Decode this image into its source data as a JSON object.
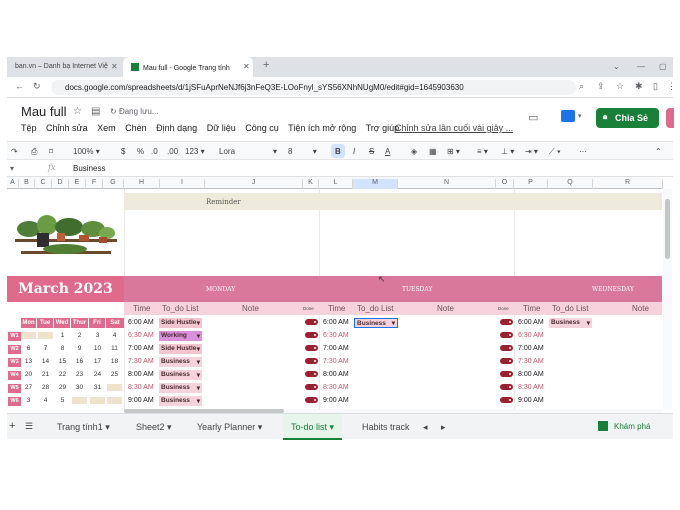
{
  "browser": {
    "tabs": [
      {
        "label": "ban.vn – Danh bạ Internet Việ"
      },
      {
        "label": "Mau full - Google Trang tính"
      }
    ],
    "url": "docs.google.com/spreadsheets/d/1jSFuAprNeNJf6j3nFeQ3E-LOoFnyl_sYS56XNhNUgM0/edit#gid=1645903630"
  },
  "sheets": {
    "doc_title": "Mau full",
    "saving_status": "Đang lưu...",
    "menu": [
      "Tệp",
      "Chỉnh sửa",
      "Xem",
      "Chèn",
      "Định dạng",
      "Dữ liệu",
      "Công cụ",
      "Tiện ích mở rộng",
      "Trợ giúp"
    ],
    "last_edit": "Chỉnh sửa lần cuối vài giây ...",
    "share_label": "Chia Sẻ",
    "toolbar": {
      "zoom": "100%",
      "currency": "$",
      "percent": "%",
      "dec_less": ".0",
      "dec_more": ".00",
      "format": "123",
      "font": "Lora",
      "size": "8",
      "bold": "B",
      "italic": "I",
      "strike": "S",
      "textcolor": "A"
    },
    "formula_value": "Business",
    "columns": [
      "A",
      "B",
      "C",
      "D",
      "E",
      "F",
      "G",
      "H",
      "I",
      "J",
      "K",
      "L",
      "M",
      "N",
      "O",
      "P",
      "Q",
      "R"
    ]
  },
  "planner": {
    "reminder": "Reminder",
    "month": "March 2023",
    "days": [
      "MONDAY",
      "TUESDAY",
      "WEDNESDAY"
    ],
    "subheaders": {
      "time": "Time",
      "todo": "To_do List",
      "note": "Note",
      "done": "Done"
    },
    "cal_days": [
      "Mon",
      "Tue",
      "Wed",
      "Thur",
      "Fri",
      "Sat"
    ],
    "weeks": [
      {
        "label": "W1",
        "days": [
          "27",
          "28",
          "1",
          "2",
          "3",
          "4"
        ],
        "dim": [
          true,
          true,
          false,
          false,
          false,
          false
        ]
      },
      {
        "label": "W2",
        "days": [
          "6",
          "7",
          "8",
          "9",
          "10",
          "11"
        ],
        "dim": [
          false,
          false,
          false,
          false,
          false,
          false
        ]
      },
      {
        "label": "W3",
        "days": [
          "13",
          "14",
          "15",
          "16",
          "17",
          "18"
        ],
        "dim": [
          false,
          false,
          false,
          false,
          false,
          false
        ]
      },
      {
        "label": "W4",
        "days": [
          "20",
          "21",
          "22",
          "23",
          "24",
          "25"
        ],
        "dim": [
          false,
          false,
          false,
          false,
          false,
          false
        ]
      },
      {
        "label": "W5",
        "days": [
          "27",
          "28",
          "29",
          "30",
          "31",
          "1"
        ],
        "dim": [
          false,
          false,
          false,
          false,
          false,
          true
        ]
      },
      {
        "label": "W6",
        "days": [
          "3",
          "4",
          "5",
          "6",
          "7",
          "8"
        ],
        "dim": [
          false,
          false,
          false,
          true,
          true,
          true
        ]
      }
    ],
    "rows": [
      {
        "time": "6:00 AM",
        "mon": "Side Hustle",
        "tue": "Business",
        "wed": "Business"
      },
      {
        "time": "6:30 AM",
        "mon": "Working",
        "tue": "",
        "wed": ""
      },
      {
        "time": "7:00 AM",
        "mon": "Side Hustle",
        "tue": "",
        "wed": ""
      },
      {
        "time": "7:30 AM",
        "mon": "Business",
        "tue": "",
        "wed": ""
      },
      {
        "time": "8:00 AM",
        "mon": "Business",
        "tue": "",
        "wed": ""
      },
      {
        "time": "8:30 AM",
        "mon": "Business",
        "tue": "",
        "wed": ""
      },
      {
        "time": "9:00 AM",
        "mon": "Business",
        "tue": "",
        "wed": ""
      }
    ],
    "colors": {
      "accent": "#e06a8c",
      "chip_mon": "#f3c6cf",
      "chip_working": "#d98fd9",
      "toggle": "#9b2130"
    }
  },
  "sheet_tabs": [
    "Trang tính1",
    "Sheet2",
    "Yearly Planner",
    "To-do list",
    "Habits track"
  ],
  "active_sheet_tab": "To-do list",
  "explore_label": "Khám phá"
}
